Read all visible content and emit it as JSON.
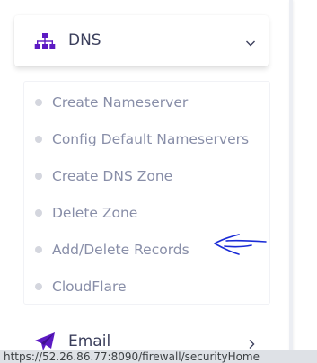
{
  "dns_menu": {
    "label": "DNS",
    "icon": "sitemap-icon",
    "expanded": true
  },
  "dns_submenu": [
    {
      "label": "Create Nameserver"
    },
    {
      "label": "Config Default Nameservers"
    },
    {
      "label": "Create DNS Zone"
    },
    {
      "label": "Delete Zone"
    },
    {
      "label": "Add/Delete Records"
    },
    {
      "label": "CloudFlare"
    }
  ],
  "annotation": {
    "icon": "hand-drawn-arrow-left-icon",
    "color": "#1a2bd6",
    "points_to": "Add/Delete Records"
  },
  "email_menu": {
    "label": "Email",
    "icon": "paper-plane-icon"
  },
  "status_bar": {
    "url": "https://52.26.86.77:8090/firewall/securityHome"
  },
  "colors": {
    "accent_icon": "#5c1ac3",
    "menu_text": "#3b3f5c",
    "submenu_text": "#888ea8",
    "bullet": "#d4d6de"
  }
}
